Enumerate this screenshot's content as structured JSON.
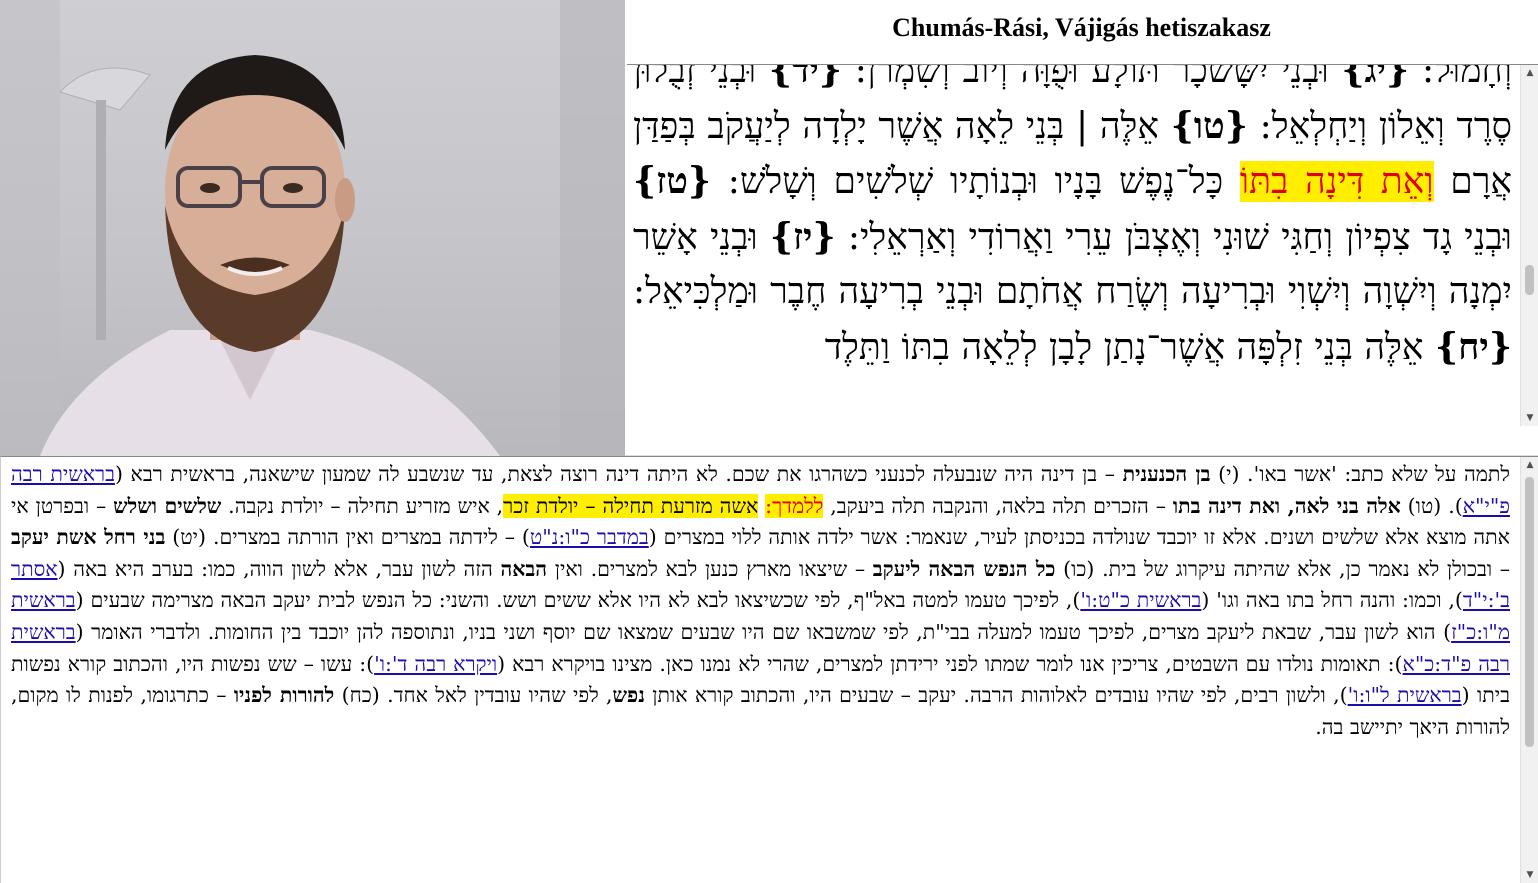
{
  "title": "Chumás-Rási, Vájigás hetiszakasz",
  "verse_pane": {
    "lines": [
      "וְחָמוּל:",
      "{יג}",
      "וּבְנֵי יִשָּׂשכָר תּוֹלָע וּפֻוָּה וְיוֹב וְשִׁמְרֹן:",
      "{יד}",
      "וּבְנֵי זְבֻלוּן סֶרֶד וְאֵלוֹן וְיַחְלְאֵל:",
      "{טו}",
      "אֵלֶּה | בְּנֵי לֵאָה אֲשֶׁר יָלְדָה לְיַעֲקֹב בְּפַדַּן אֲרָם",
      "וְאֵת דִּינָה בִתּוֹ",
      "כָּל־נֶפֶשׁ בָּנָיו וּבְנוֹתָיו שְׁלֹשִׁים וְשָׁלֹשׁ:",
      "{טז}",
      "וּבְנֵי גָד צִפְיוֹן וְחַגִּי שׁוּנִי וְאֶצְבֹּן עֵרִי וַאֲרוֹדִי וְאַרְאֵלִי:",
      "{יז}",
      "וּבְנֵי אָשֵׁר יִמְנָה וְיִשְׁוָה וְיִשְׁוִי וּבְרִיעָה וְשֶׂרַח אֲחֹתָם וּבְנֵי בְרִיעָה חֶבֶר וּמַלְכִּיאֵל:",
      "{יח}",
      "אֵלֶּה בְּנֵי זִלְפָּה אֲשֶׁר־נָתַן לָבָן לְלֵאָה בִתּוֹ וַתֵּלֶד"
    ]
  },
  "rashi": {
    "segments": [
      {
        "t": "לתמה על שלא כתב: 'אשר באו'. (י) ",
        "s": ""
      },
      {
        "t": "בן הכנענית",
        "s": "b"
      },
      {
        "t": " – בן דינה היה שנבעלה לכנעני כשהרגו את שכם. לא היתה דינה רוצה לצאת, עד שנשבע לה שמעון שישאנה, בראשית רבא (",
        "s": ""
      },
      {
        "t": "בראשית רבה פ\"י\"א",
        "s": "a"
      },
      {
        "t": "). (טו) ",
        "s": ""
      },
      {
        "t": "אלה בני לאה, ואת דינה בתו",
        "s": "b"
      },
      {
        "t": " – הזכרים תלה בלאה, והנקבה תלה ביעקב, ",
        "s": ""
      },
      {
        "t": "ללמדך:",
        "s": "hlr"
      },
      {
        "t": " ",
        "s": ""
      },
      {
        "t": "אשה מזרעת תחילה – יולדת זכר",
        "s": "hl"
      },
      {
        "t": ", איש מזריע תחילה – יולדת נקבה. ",
        "s": ""
      },
      {
        "t": "שלשים ושלש",
        "s": "b"
      },
      {
        "t": " – ובפרטן אי אתה מוצא אלא שלשים ושנים. אלא זו יוכבד שנולדה בכניסתן לעיר, שנאמר: אשר ילדה אותה ללוי במצרים (",
        "s": ""
      },
      {
        "t": "במדבר כ\"ו:נ\"ט",
        "s": "a"
      },
      {
        "t": ") – לידתה במצרים ואין הורתה במצרים. (יט) ",
        "s": ""
      },
      {
        "t": "בני רחל אשת יעקב",
        "s": "b"
      },
      {
        "t": " – ובכולן לא נאמר כן, אלא שהיתה עיקרוג של בית. (כו) ",
        "s": ""
      },
      {
        "t": "כל הנפש הבאה ליעקב",
        "s": "b"
      },
      {
        "t": " – שיצאו מארץ כנען לבא למצרים. ואין ",
        "s": ""
      },
      {
        "t": "הבאה",
        "s": "b"
      },
      {
        "t": " הזה לשון עבר, אלא לשון הווה, כמו: בערב היא באה (",
        "s": ""
      },
      {
        "t": "אסתר ב':י\"ד",
        "s": "a"
      },
      {
        "t": "), וכמו: והנה רחל בתו באה וגו' (",
        "s": ""
      },
      {
        "t": "בראשית כ\"ט:ו'",
        "s": "a"
      },
      {
        "t": "), לפיכך טעמו למטה באל\"ף, לפי שכשיצאו לבא לא היו אלא ששים ושש. והשני: כל הנפש לבית יעקב הבאה מצרימה שבעים (",
        "s": ""
      },
      {
        "t": "בראשית מ\"ו:כ\"ז",
        "s": "a"
      },
      {
        "t": ") הוא לשון עבר, שבאת ליעקב מצרים, לפיכך טעמו למעלה בבי\"ת, לפי שמשבאו שם היו שבעים שמצאו שם יוסף ושני בניו, ונתוספה להן יוכבד בין החומות. ולדברי האומר (",
        "s": ""
      },
      {
        "t": "בראשית רבה פ\"ד:כ\"א",
        "s": "a"
      },
      {
        "t": "): תאומות נולדו עם השבטים, צריכין אנו לומר שמתו לפני ירידתן למצרים, שהרי לא נמנו כאן. מצינו בויקרא רבא (",
        "s": ""
      },
      {
        "t": "ויקרא רבה ד':ו'",
        "s": "a"
      },
      {
        "t": "): עשו – שש נפשות היו, והכתוב קורא נפשות ביתו (",
        "s": ""
      },
      {
        "t": "בראשית ל\"ו:ו'",
        "s": "a"
      },
      {
        "t": "), ולשון רבים, לפי שהיו עובדים לאלוהות הרבה. יעקב – שבעים היו, והכתוב קורא אותן ",
        "s": ""
      },
      {
        "t": "נפש",
        "s": "b"
      },
      {
        "t": ", לפי שהיו עובדין לאל אחד. (כח) ",
        "s": ""
      },
      {
        "t": "להורות לפניו",
        "s": "b"
      },
      {
        "t": " – כתרגומו, לפנות לו מקום, להורות היאך יתיישב בה.",
        "s": ""
      }
    ]
  },
  "colors": {
    "highlight_bg": "#ffee00",
    "highlight_text": "#e00000",
    "link": "#1a0dab"
  },
  "icons": {
    "scroll_up": "▲",
    "scroll_down": "▼"
  }
}
